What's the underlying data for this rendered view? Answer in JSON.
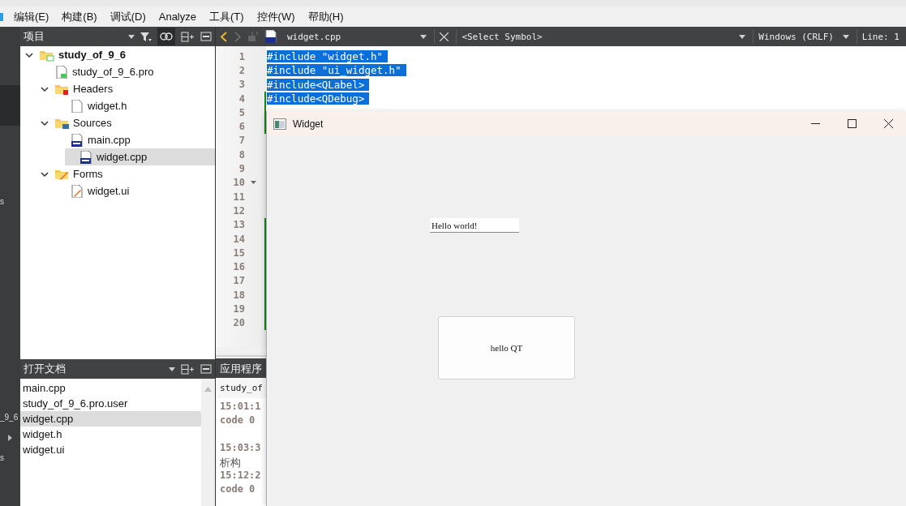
{
  "menu_bar": {
    "items": [
      "编辑(E)",
      "构建(B)",
      "调试(D)",
      "Analyze",
      "工具(T)",
      "控件(W)",
      "帮助(H)"
    ]
  },
  "left_strip": {
    "labels": [
      "s",
      "_9_6",
      "s"
    ]
  },
  "project_panel": {
    "title": "项目",
    "tree": [
      {
        "label": "study_of_9_6",
        "kind": "project",
        "expanded": true,
        "selected": false,
        "children": [
          {
            "label": "study_of_9_6.pro",
            "kind": "pro",
            "selected": false
          },
          {
            "label": "Headers",
            "kind": "folder-h",
            "expanded": true,
            "selected": false,
            "children": [
              {
                "label": "widget.h",
                "kind": "header",
                "selected": false
              }
            ]
          },
          {
            "label": "Sources",
            "kind": "folder-cpp",
            "expanded": true,
            "selected": false,
            "children": [
              {
                "label": "main.cpp",
                "kind": "cpp",
                "selected": false
              },
              {
                "label": "widget.cpp",
                "kind": "cpp",
                "selected": true
              }
            ]
          },
          {
            "label": "Forms",
            "kind": "folder-forms",
            "expanded": true,
            "selected": false,
            "children": [
              {
                "label": "widget.ui",
                "kind": "ui",
                "selected": false
              }
            ]
          }
        ]
      }
    ]
  },
  "open_documents": {
    "title": "打开文档",
    "items": [
      {
        "label": "main.cpp",
        "selected": false
      },
      {
        "label": "study_of_9_6.pro.user",
        "selected": false
      },
      {
        "label": "widget.cpp",
        "selected": true
      },
      {
        "label": "widget.h",
        "selected": false
      },
      {
        "label": "widget.ui",
        "selected": false
      }
    ]
  },
  "editor": {
    "file": "widget.cpp",
    "symbol": "<Select Symbol>",
    "line_endings": "Windows (CRLF)",
    "position": "Line: 1",
    "lines": [
      {
        "number": "1",
        "text": "#include \"widget.h\"",
        "selected": true,
        "changed": false,
        "foldable": false
      },
      {
        "number": "2",
        "text": "#include \"ui_widget.h\"",
        "selected": true,
        "changed": false,
        "foldable": false
      },
      {
        "number": "3",
        "text": "#include<QLabel>",
        "selected": true,
        "changed": false,
        "foldable": false
      },
      {
        "number": "4",
        "text": "#include<QDebug>",
        "selected": true,
        "changed": true,
        "foldable": false
      },
      {
        "number": "5",
        "selected": false,
        "changed": true,
        "foldable": false
      },
      {
        "number": "6",
        "selected": false,
        "changed": true,
        "foldable": false
      },
      {
        "number": "7",
        "selected": false,
        "changed": false,
        "foldable": false
      },
      {
        "number": "8",
        "selected": false,
        "changed": false,
        "foldable": false
      },
      {
        "number": "9",
        "selected": false,
        "changed": false,
        "foldable": false
      },
      {
        "number": "10",
        "selected": false,
        "changed": false,
        "foldable": true
      },
      {
        "number": "11",
        "selected": false,
        "changed": false,
        "foldable": false
      },
      {
        "number": "12",
        "selected": false,
        "changed": false,
        "foldable": false
      },
      {
        "number": "13",
        "selected": false,
        "changed": true,
        "foldable": false
      },
      {
        "number": "14",
        "selected": false,
        "changed": true,
        "foldable": false
      },
      {
        "number": "15",
        "selected": false,
        "changed": true,
        "foldable": false
      },
      {
        "number": "16",
        "selected": false,
        "changed": true,
        "foldable": false
      },
      {
        "number": "17",
        "selected": false,
        "changed": true,
        "foldable": false
      },
      {
        "number": "18",
        "selected": false,
        "changed": true,
        "foldable": false
      },
      {
        "number": "19",
        "selected": false,
        "changed": true,
        "foldable": false
      },
      {
        "number": "20",
        "selected": false,
        "changed": true,
        "foldable": false
      }
    ]
  },
  "output_panel": {
    "title": "应用程序",
    "tab": "study_of",
    "lines": [
      {
        "text": "15:01:1",
        "kind": "mono"
      },
      {
        "text": "code 0",
        "kind": "mono"
      },
      {
        "kind": "blank"
      },
      {
        "text": "15:03:3",
        "kind": "mono"
      },
      {
        "text": "析构",
        "kind": "plain"
      },
      {
        "text": "15:12:2",
        "kind": "mono"
      },
      {
        "text": "code 0",
        "kind": "mono"
      }
    ]
  },
  "widget_window": {
    "title": "Widget",
    "label": "Hello world!",
    "button": "hello QT"
  }
}
